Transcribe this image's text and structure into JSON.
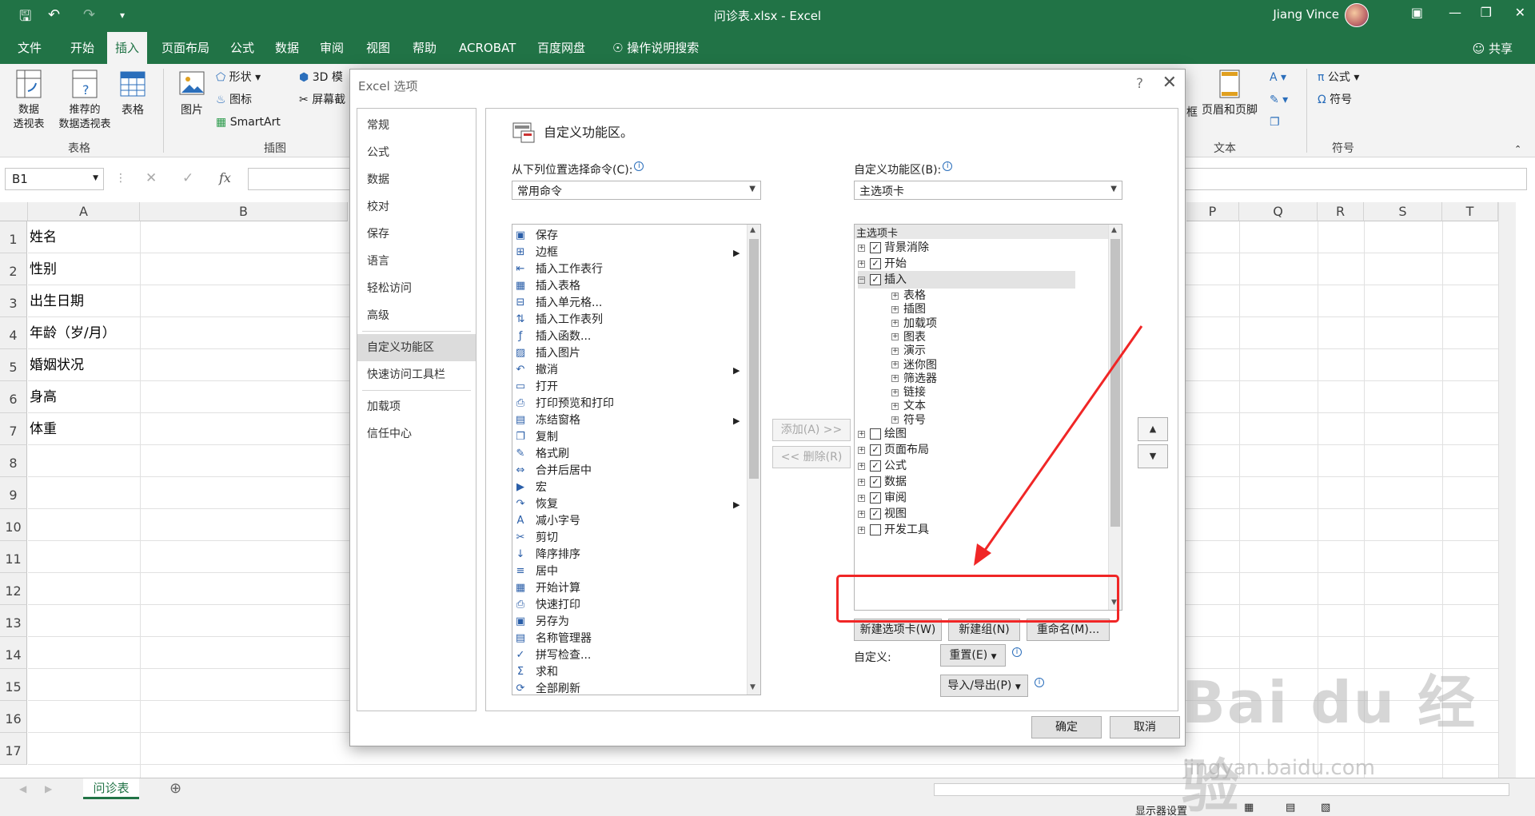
{
  "window": {
    "doc_title": "问诊表.xlsx - Excel",
    "user_name": "Jiang Vince"
  },
  "ribbon_tabs": [
    "文件",
    "开始",
    "插入",
    "页面布局",
    "公式",
    "数据",
    "审阅",
    "视图",
    "帮助",
    "ACROBAT",
    "百度网盘"
  ],
  "tell_me": "操作说明搜索",
  "share_label": "共享",
  "ribbon": {
    "pivot": "数据\n透视表",
    "rec_pivot": "推荐的\n数据透视表",
    "table": "表格",
    "group_tables": "表格",
    "pictures": "图片",
    "shapes": "形状",
    "icons": "图标",
    "smartart": "SmartArt",
    "model3d": "3D 模",
    "screenshot": "屏幕截",
    "group_illustrations": "插图",
    "textbox_partial": "框",
    "header_footer": "页眉和页脚",
    "group_text": "文本",
    "equation": "公式",
    "symbol": "符号",
    "group_symbols": "符号"
  },
  "formula_bar": {
    "name_box": "B1",
    "fx": "fx"
  },
  "columns": [
    "A",
    "B",
    "P",
    "Q",
    "R",
    "S",
    "T"
  ],
  "rows": [
    {
      "n": "1",
      "a": "姓名"
    },
    {
      "n": "2",
      "a": "性别"
    },
    {
      "n": "3",
      "a": "出生日期"
    },
    {
      "n": "4",
      "a": "年龄（岁/月）"
    },
    {
      "n": "5",
      "a": "婚姻状况"
    },
    {
      "n": "6",
      "a": "身高"
    },
    {
      "n": "7",
      "a": "体重"
    },
    {
      "n": "8",
      "a": ""
    },
    {
      "n": "9",
      "a": ""
    },
    {
      "n": "10",
      "a": ""
    },
    {
      "n": "11",
      "a": ""
    },
    {
      "n": "12",
      "a": ""
    },
    {
      "n": "13",
      "a": ""
    },
    {
      "n": "14",
      "a": ""
    },
    {
      "n": "15",
      "a": ""
    },
    {
      "n": "16",
      "a": ""
    },
    {
      "n": "17",
      "a": ""
    }
  ],
  "sheet_tab": "问诊表",
  "status": {
    "display_settings": "显示器设置"
  },
  "dialog": {
    "title": "Excel 选项",
    "help": "?",
    "close": "✕",
    "categories": [
      "常规",
      "公式",
      "数据",
      "校对",
      "保存",
      "语言",
      "轻松访问",
      "高级",
      "自定义功能区",
      "快速访问工具栏",
      "加载项",
      "信任中心"
    ],
    "selected_category": "自定义功能区",
    "panel_title": "自定义功能区。",
    "choose_from_label": "从下列位置选择命令(C):",
    "choose_from_value": "常用命令",
    "customize_label": "自定义功能区(B):",
    "customize_value": "主选项卡",
    "commands": [
      {
        "icon": "save-icon",
        "glyph": "▣",
        "label": "保存",
        "sub": false
      },
      {
        "icon": "border-icon",
        "glyph": "⊞",
        "label": "边框",
        "sub": true
      },
      {
        "icon": "insert-row-icon",
        "glyph": "⇤",
        "label": "插入工作表行",
        "sub": false
      },
      {
        "icon": "table-icon",
        "glyph": "▦",
        "label": "插入表格",
        "sub": false
      },
      {
        "icon": "insert-cell-icon",
        "glyph": "⊟",
        "label": "插入单元格...",
        "sub": false
      },
      {
        "icon": "insert-col-icon",
        "glyph": "⇅",
        "label": "插入工作表列",
        "sub": false
      },
      {
        "icon": "function-icon",
        "glyph": "ƒ",
        "label": "插入函数...",
        "sub": false
      },
      {
        "icon": "picture-icon",
        "glyph": "▨",
        "label": "插入图片",
        "sub": false
      },
      {
        "icon": "undo-icon",
        "glyph": "↶",
        "label": "撤消",
        "sub": true
      },
      {
        "icon": "open-icon",
        "glyph": "▭",
        "label": "打开",
        "sub": false
      },
      {
        "icon": "print-preview-icon",
        "glyph": "⎙",
        "label": "打印预览和打印",
        "sub": false
      },
      {
        "icon": "freeze-icon",
        "glyph": "▤",
        "label": "冻结窗格",
        "sub": true
      },
      {
        "icon": "copy-icon",
        "glyph": "❐",
        "label": "复制",
        "sub": false
      },
      {
        "icon": "format-painter-icon",
        "glyph": "✎",
        "label": "格式刷",
        "sub": false
      },
      {
        "icon": "merge-icon",
        "glyph": "⇔",
        "label": "合并后居中",
        "sub": false
      },
      {
        "icon": "macro-icon",
        "glyph": "▶",
        "label": "宏",
        "sub": false
      },
      {
        "icon": "redo-icon",
        "glyph": "↷",
        "label": "恢复",
        "sub": true
      },
      {
        "icon": "decrease-font-icon",
        "glyph": "A",
        "label": "减小字号",
        "sub": false
      },
      {
        "icon": "cut-icon",
        "glyph": "✂",
        "label": "剪切",
        "sub": false
      },
      {
        "icon": "sort-desc-icon",
        "glyph": "↓",
        "label": "降序排序",
        "sub": false
      },
      {
        "icon": "center-icon",
        "glyph": "≡",
        "label": "居中",
        "sub": false
      },
      {
        "icon": "calculate-icon",
        "glyph": "▦",
        "label": "开始计算",
        "sub": false
      },
      {
        "icon": "quick-print-icon",
        "glyph": "⎙",
        "label": "快速打印",
        "sub": false
      },
      {
        "icon": "save-as-icon",
        "glyph": "▣",
        "label": "另存为",
        "sub": false
      },
      {
        "icon": "name-manager-icon",
        "glyph": "▤",
        "label": "名称管理器",
        "sub": false
      },
      {
        "icon": "spelling-icon",
        "glyph": "✓",
        "label": "拼写检查...",
        "sub": false
      },
      {
        "icon": "sum-icon",
        "glyph": "Σ",
        "label": "求和",
        "sub": false
      },
      {
        "icon": "refresh-all-icon",
        "glyph": "⟳",
        "label": "全部刷新",
        "sub": false
      }
    ],
    "add_button": "添加(A) >>",
    "remove_button": "<< 删除(R)",
    "tree_header": "主选项卡",
    "tree": [
      {
        "label": "背景消除",
        "level": 0,
        "expand": "+",
        "checked": true
      },
      {
        "label": "开始",
        "level": 0,
        "expand": "+",
        "checked": true
      },
      {
        "label": "插入",
        "level": 0,
        "expand": "−",
        "checked": true,
        "selected": true
      },
      {
        "label": "表格",
        "level": 1,
        "expand": "+",
        "checked": null
      },
      {
        "label": "插图",
        "level": 1,
        "expand": "+",
        "checked": null
      },
      {
        "label": "加载项",
        "level": 1,
        "expand": "+",
        "checked": null
      },
      {
        "label": "图表",
        "level": 1,
        "expand": "+",
        "checked": null
      },
      {
        "label": "演示",
        "level": 1,
        "expand": "+",
        "checked": null
      },
      {
        "label": "迷你图",
        "level": 1,
        "expand": "+",
        "checked": null
      },
      {
        "label": "筛选器",
        "level": 1,
        "expand": "+",
        "checked": null
      },
      {
        "label": "链接",
        "level": 1,
        "expand": "+",
        "checked": null
      },
      {
        "label": "文本",
        "level": 1,
        "expand": "+",
        "checked": null
      },
      {
        "label": "符号",
        "level": 1,
        "expand": "+",
        "checked": null
      },
      {
        "label": "绘图",
        "level": 0,
        "expand": "+",
        "checked": false
      },
      {
        "label": "页面布局",
        "level": 0,
        "expand": "+",
        "checked": true
      },
      {
        "label": "公式",
        "level": 0,
        "expand": "+",
        "checked": true
      },
      {
        "label": "数据",
        "level": 0,
        "expand": "+",
        "checked": true
      },
      {
        "label": "审阅",
        "level": 0,
        "expand": "+",
        "checked": true
      },
      {
        "label": "视图",
        "level": 0,
        "expand": "+",
        "checked": true
      },
      {
        "label": "开发工具",
        "level": 0,
        "expand": "+",
        "checked": false
      }
    ],
    "new_tab_button": "新建选项卡(W)",
    "new_group_button": "新建组(N)",
    "rename_button": "重命名(M)...",
    "customizations_label": "自定义:",
    "reset_button": "重置(E)",
    "import_export_button": "导入/导出(P)",
    "ok_button": "确定",
    "cancel_button": "取消"
  },
  "watermark": {
    "brand": "Bai du 经验",
    "url": "jingyan.baidu.com"
  },
  "colors": {
    "excel_green": "#217346",
    "annotation_red": "#f02626"
  }
}
